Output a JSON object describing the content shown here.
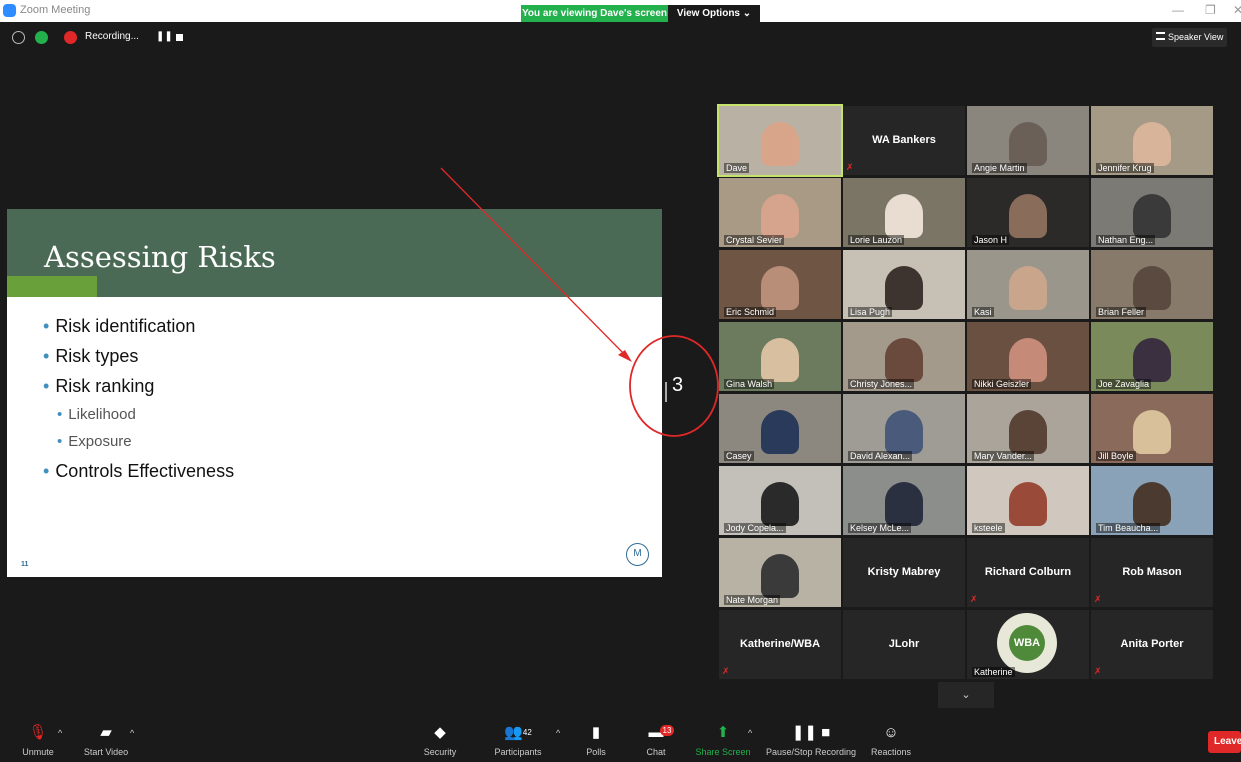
{
  "window": {
    "title": "Zoom Meeting"
  },
  "banner": {
    "viewing": "You are viewing Dave's screen",
    "view_options": "View Options ⌄"
  },
  "status": {
    "recording": "Recording...",
    "speaker_view": "Speaker View"
  },
  "slide": {
    "title": "Assessing Risks",
    "bullets": [
      "Risk identification",
      "Risk types",
      "Risk ranking"
    ],
    "sub_bullets": [
      "Likelihood",
      "Exposure"
    ],
    "last_bullet": "Controls Effectiveness",
    "page_number": "11"
  },
  "annotation": {
    "number": "3"
  },
  "participants": [
    {
      "name": "Dave"
    },
    {
      "name": "WA Bankers"
    },
    {
      "name": "Angie Martin"
    },
    {
      "name": "Jennifer Krug"
    },
    {
      "name": "Crystal Sevier"
    },
    {
      "name": "Lorie Lauzon"
    },
    {
      "name": "Jason H"
    },
    {
      "name": "Nathan Eng..."
    },
    {
      "name": "Eric Schmid"
    },
    {
      "name": "Lisa Pugh"
    },
    {
      "name": "Kasi"
    },
    {
      "name": "Brian Feller"
    },
    {
      "name": "Gina Walsh"
    },
    {
      "name": "Christy Jones..."
    },
    {
      "name": "Nikki Geiszler"
    },
    {
      "name": "Joe Zavaglia"
    },
    {
      "name": "Casey"
    },
    {
      "name": "David Alexan..."
    },
    {
      "name": "Mary Vander..."
    },
    {
      "name": "Jill Boyle"
    },
    {
      "name": "Jody Copela..."
    },
    {
      "name": "Kelsey McLe..."
    },
    {
      "name": "ksteele"
    },
    {
      "name": "Tim Beaucha..."
    },
    {
      "name": "Nate Morgan"
    },
    {
      "name": "Kristy Mabrey"
    },
    {
      "name": "Richard Colburn"
    },
    {
      "name": "Rob Mason"
    },
    {
      "name": "Katherine/WBA"
    },
    {
      "name": "JLohr"
    },
    {
      "name": "Katherine"
    },
    {
      "name": "Anita Porter"
    }
  ],
  "wba_logo": "WBA",
  "toolbar": {
    "unmute": "Unmute",
    "start_video": "Start Video",
    "security": "Security",
    "participants": "Participants",
    "participant_count": "42",
    "polls": "Polls",
    "chat": "Chat",
    "chat_badge": "13",
    "share_screen": "Share Screen",
    "pause_recording": "Pause/Stop Recording",
    "reactions": "Reactions",
    "leave": "Leave"
  },
  "colors": {
    "accent_green": "#23b14d",
    "slide_header": "#4a6a55",
    "mute_red": "#e02828",
    "active_speaker": "#c5e26b"
  }
}
